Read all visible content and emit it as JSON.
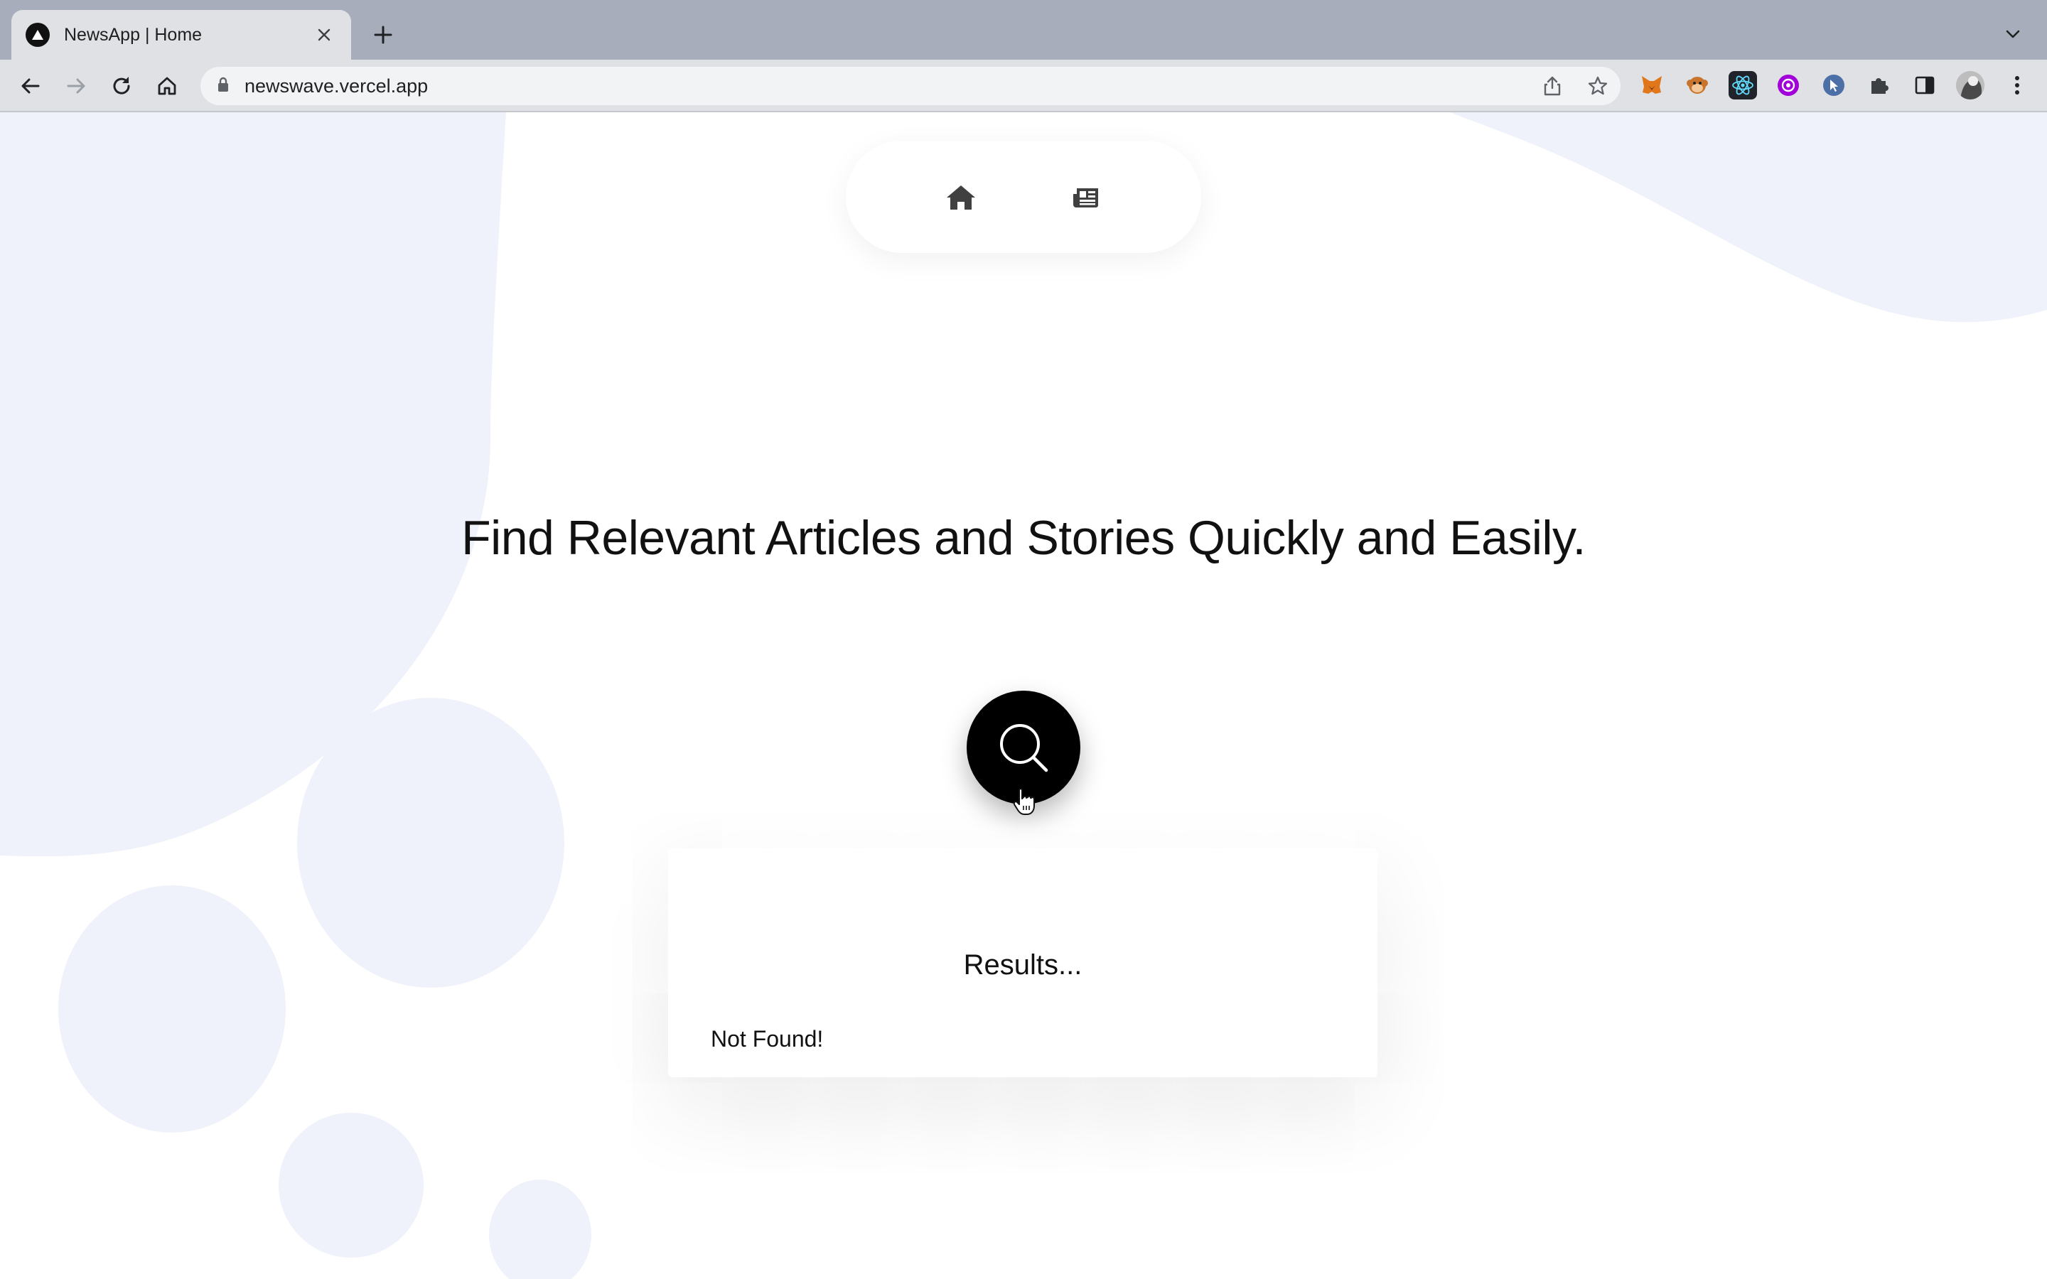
{
  "browser": {
    "tab_title": "NewsApp | Home",
    "url": "newswave.vercel.app"
  },
  "icons": {
    "tab": [
      "vercel-favicon-icon",
      "close-icon",
      "plus-icon",
      "chevron-down-icon"
    ],
    "toolbar": [
      "back-arrow-icon",
      "forward-arrow-icon",
      "reload-icon",
      "home-icon",
      "lock-icon",
      "share-icon",
      "star-icon",
      "puzzle-icon",
      "side-panel-icon",
      "kebab-menu-icon"
    ],
    "extensions": [
      "metamask-fox-icon",
      "monkey-icon",
      "react-devtools-icon",
      "purple-extension-icon",
      "cursor-extension-icon"
    ],
    "page": [
      "home-icon",
      "newspaper-icon",
      "search-icon"
    ]
  },
  "page": {
    "headline": "Find Relevant Articles and Stories Quickly and Easily.",
    "results": {
      "title": "Results...",
      "empty_message": "Not Found!"
    }
  },
  "colors": {
    "blob": "#eff2fa",
    "search_button": "#000000",
    "tab_strip": "#a8adbb",
    "toolbar": "#dfe1e5"
  }
}
